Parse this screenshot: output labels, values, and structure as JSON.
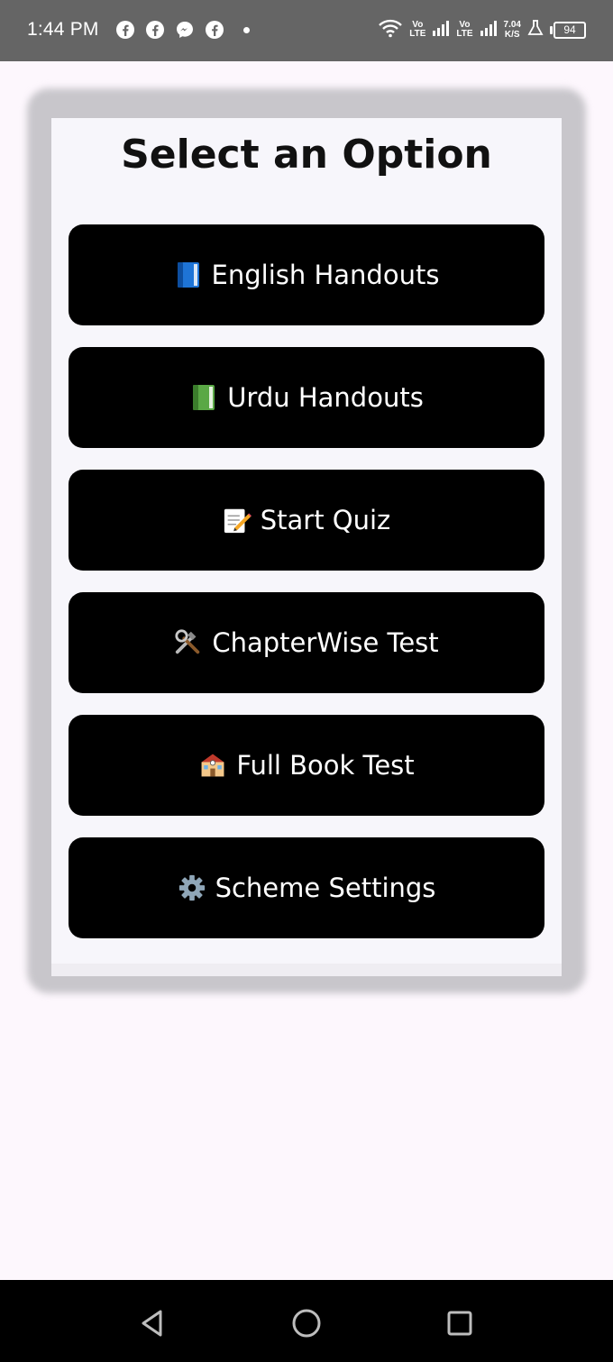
{
  "status_bar": {
    "time": "1:44 PM",
    "notifications": [
      "facebook-icon",
      "facebook-icon",
      "messenger-icon",
      "facebook-icon"
    ],
    "lte1_top": "Vo",
    "lte1_bottom": "LTE",
    "lte2_top": "Vo",
    "lte2_bottom": "LTE",
    "speed_value": "7.04",
    "speed_unit": "K/S",
    "battery": "94"
  },
  "screen": {
    "title": "Select an Option",
    "options": [
      {
        "label": "English Handouts",
        "icon": "blue-book-icon"
      },
      {
        "label": "Urdu Handouts",
        "icon": "green-book-icon"
      },
      {
        "label": "Start Quiz",
        "icon": "memo-pencil-icon"
      },
      {
        "label": "ChapterWise Test",
        "icon": "hammer-wrench-icon"
      },
      {
        "label": "Full Book Test",
        "icon": "school-icon"
      },
      {
        "label": "Scheme Settings",
        "icon": "gear-icon"
      }
    ]
  },
  "colors": {
    "status_bar_bg": "#656565",
    "page_bg": "#fdf7fd",
    "button_bg": "#000000",
    "button_text": "#ffffff"
  }
}
